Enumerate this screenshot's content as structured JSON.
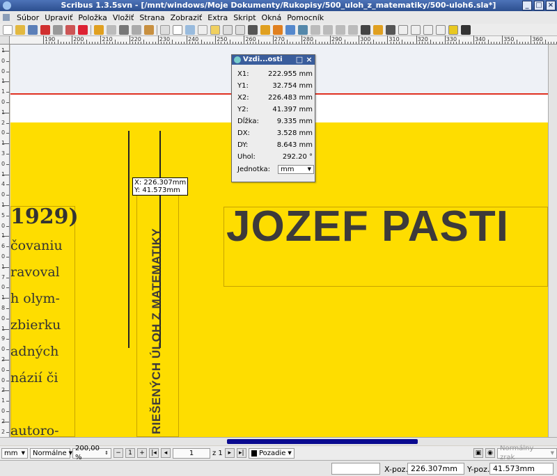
{
  "window": {
    "title": "Scribus 1.3.5svn - [/mnt/windows/Moje Dokumenty/Rukopisy/500_uloh_z_matematiky/500-uloh6.sla*]"
  },
  "menu": [
    "Súbor",
    "Upraviť",
    "Položka",
    "Vložiť",
    "Strana",
    "Zobraziť",
    "Extra",
    "Skript",
    "Okná",
    "Pomocník"
  ],
  "ruler": {
    "h_labels": [
      "190",
      "200",
      "210",
      "220",
      "230",
      "240",
      "250",
      "260",
      "270",
      "280",
      "290",
      "300",
      "310",
      "320",
      "330",
      "340",
      "350",
      "360"
    ],
    "v_labels": [
      "1",
      "0",
      "0",
      "1",
      "1",
      "0",
      "1",
      "2",
      "0",
      "1",
      "3",
      "0",
      "1",
      "4",
      "0",
      "1",
      "5",
      "0",
      "1",
      "6",
      "0",
      "1",
      "7",
      "0",
      "1",
      "8",
      "0",
      "1",
      "9",
      "0",
      "2",
      "0",
      "0",
      "2",
      "1",
      "0",
      "2",
      "2"
    ]
  },
  "document": {
    "left_lines": [
      "1929)",
      "čovaniu",
      "ravoval",
      "h olym-",
      "zbierku",
      "adných",
      "názií či",
      "autoro-"
    ],
    "headline": "JOZEF PASTI",
    "vertical_text": "RIEŠENÝCH ÚLOH Z MATEMATIKY"
  },
  "tooltip": {
    "x": "X: 226.307mm",
    "y": "Y: 41.573mm"
  },
  "measure_panel": {
    "title": "Vzdi...osti",
    "rows": [
      {
        "key": "X1:",
        "value": "222.955 mm"
      },
      {
        "key": "Y1:",
        "value": "32.754 mm"
      },
      {
        "key": "X2:",
        "value": "226.483 mm"
      },
      {
        "key": "Y2:",
        "value": "41.397 mm"
      },
      {
        "key": "Dĺžka:",
        "value": "9.335 mm"
      },
      {
        "key": "DX:",
        "value": "3.528 mm"
      },
      {
        "key": "DY:",
        "value": "8.643 mm"
      },
      {
        "key": "Uhol:",
        "value": "292.20 °"
      }
    ],
    "unit_label": "Jednotka:",
    "unit_value": "mm"
  },
  "status": {
    "unit": "mm",
    "mode": "Normálne",
    "zoom": "200,00 %",
    "page": "1",
    "page_of": "z 1",
    "layer": "Pozadie",
    "view_mode": "Normálny zrak",
    "xpos_label": "X-poz.:",
    "xpos_value": "226.307mm",
    "ypos_label": "Y-poz.:",
    "ypos_value": "41.573mm"
  },
  "colors": {
    "page_yellow": "#fedd00",
    "title_blue": "#2c4f8f",
    "text_dark": "#3d3a3a",
    "margin_red": "#e03020"
  }
}
